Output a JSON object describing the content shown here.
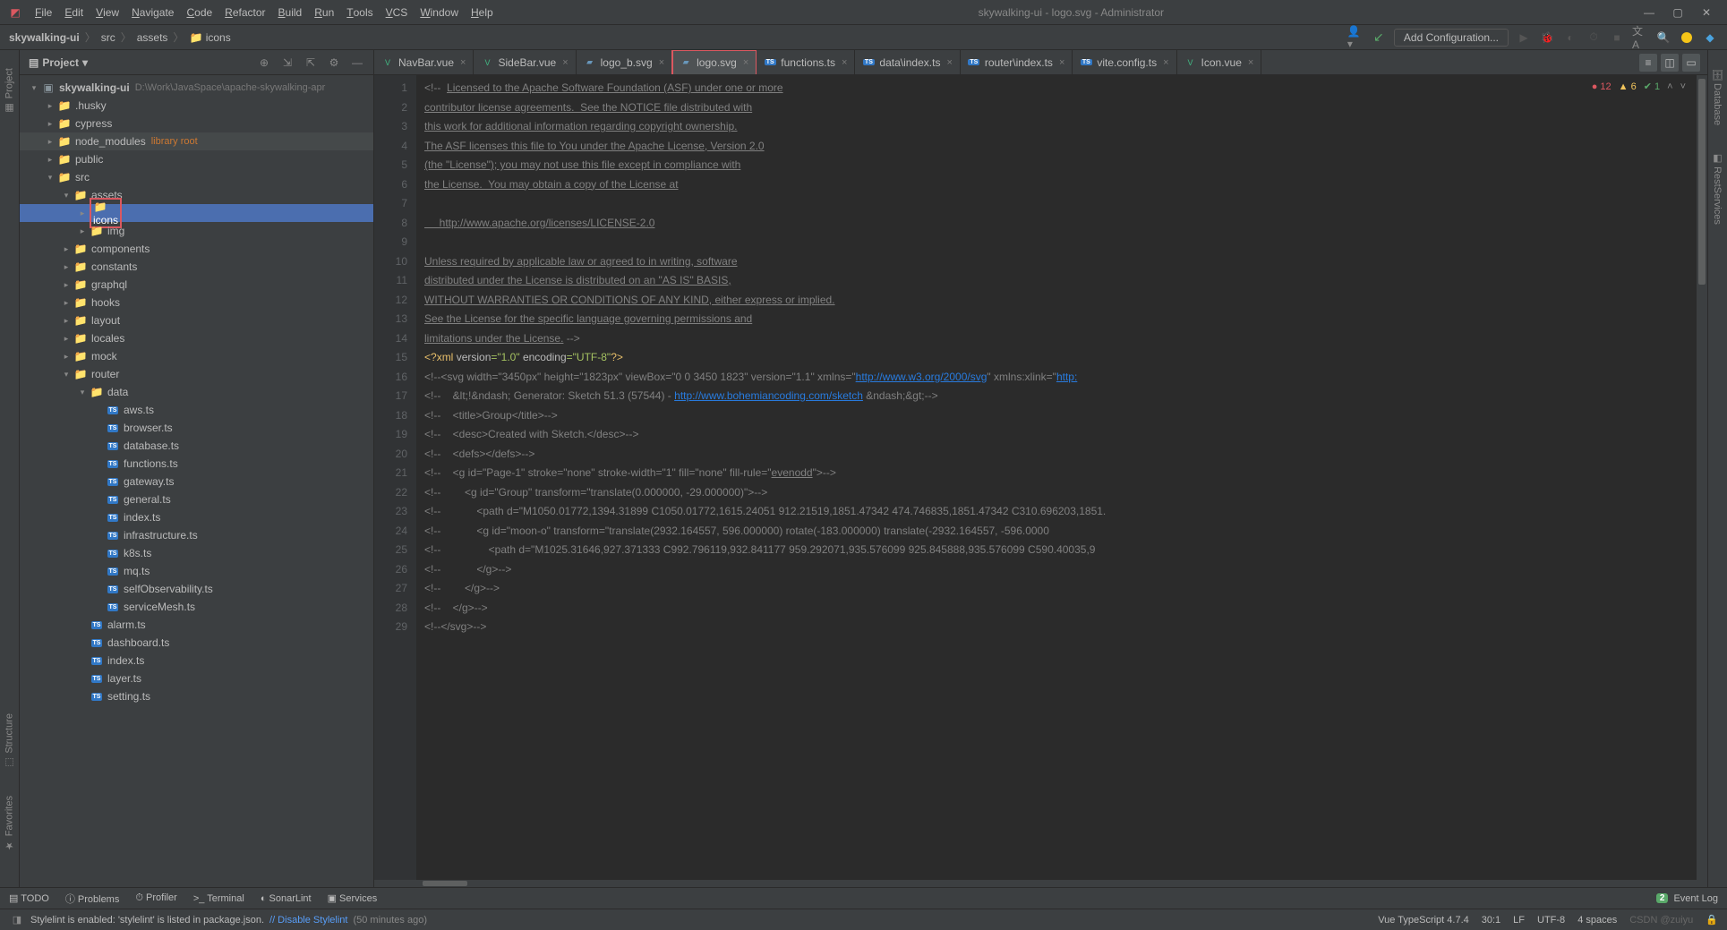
{
  "menu": [
    "File",
    "Edit",
    "View",
    "Navigate",
    "Code",
    "Refactor",
    "Build",
    "Run",
    "Tools",
    "VCS",
    "Window",
    "Help"
  ],
  "window_title": "skywalking-ui - logo.svg - Administrator",
  "breadcrumb": [
    "skywalking-ui",
    "src",
    "assets",
    "icons"
  ],
  "add_configuration": "Add Configuration...",
  "panel": {
    "title": "Project"
  },
  "tree": {
    "root": {
      "name": "skywalking-ui",
      "path": "D:\\Work\\JavaSpace\\apache-skywalking-apr"
    },
    "items": [
      {
        "indent": 1,
        "arrow": ">",
        "type": "folder",
        "name": ".husky"
      },
      {
        "indent": 1,
        "arrow": ">",
        "type": "folder",
        "name": "cypress"
      },
      {
        "indent": 1,
        "arrow": ">",
        "type": "folder",
        "name": "node_modules",
        "lib": "library root",
        "dim": true
      },
      {
        "indent": 1,
        "arrow": ">",
        "type": "folder",
        "name": "public"
      },
      {
        "indent": 1,
        "arrow": "v",
        "type": "folder",
        "name": "src"
      },
      {
        "indent": 2,
        "arrow": "v",
        "type": "folder",
        "name": "assets"
      },
      {
        "indent": 3,
        "arrow": ">",
        "type": "folder",
        "name": "icons",
        "selected": true,
        "red": true
      },
      {
        "indent": 3,
        "arrow": ">",
        "type": "folder",
        "name": "img"
      },
      {
        "indent": 2,
        "arrow": ">",
        "type": "folder",
        "name": "components"
      },
      {
        "indent": 2,
        "arrow": ">",
        "type": "folder",
        "name": "constants"
      },
      {
        "indent": 2,
        "arrow": ">",
        "type": "folder",
        "name": "graphql"
      },
      {
        "indent": 2,
        "arrow": ">",
        "type": "folder",
        "name": "hooks"
      },
      {
        "indent": 2,
        "arrow": ">",
        "type": "folder",
        "name": "layout"
      },
      {
        "indent": 2,
        "arrow": ">",
        "type": "folder",
        "name": "locales"
      },
      {
        "indent": 2,
        "arrow": ">",
        "type": "folder",
        "name": "mock"
      },
      {
        "indent": 2,
        "arrow": "v",
        "type": "folder",
        "name": "router"
      },
      {
        "indent": 3,
        "arrow": "v",
        "type": "folder",
        "name": "data"
      },
      {
        "indent": 4,
        "arrow": "",
        "type": "ts",
        "name": "aws.ts"
      },
      {
        "indent": 4,
        "arrow": "",
        "type": "ts",
        "name": "browser.ts"
      },
      {
        "indent": 4,
        "arrow": "",
        "type": "ts",
        "name": "database.ts"
      },
      {
        "indent": 4,
        "arrow": "",
        "type": "ts",
        "name": "functions.ts"
      },
      {
        "indent": 4,
        "arrow": "",
        "type": "ts",
        "name": "gateway.ts"
      },
      {
        "indent": 4,
        "arrow": "",
        "type": "ts",
        "name": "general.ts"
      },
      {
        "indent": 4,
        "arrow": "",
        "type": "ts",
        "name": "index.ts"
      },
      {
        "indent": 4,
        "arrow": "",
        "type": "ts",
        "name": "infrastructure.ts"
      },
      {
        "indent": 4,
        "arrow": "",
        "type": "ts",
        "name": "k8s.ts"
      },
      {
        "indent": 4,
        "arrow": "",
        "type": "ts",
        "name": "mq.ts"
      },
      {
        "indent": 4,
        "arrow": "",
        "type": "ts",
        "name": "selfObservability.ts"
      },
      {
        "indent": 4,
        "arrow": "",
        "type": "ts",
        "name": "serviceMesh.ts"
      },
      {
        "indent": 3,
        "arrow": "",
        "type": "ts",
        "name": "alarm.ts"
      },
      {
        "indent": 3,
        "arrow": "",
        "type": "ts",
        "name": "dashboard.ts"
      },
      {
        "indent": 3,
        "arrow": "",
        "type": "ts",
        "name": "index.ts"
      },
      {
        "indent": 3,
        "arrow": "",
        "type": "ts",
        "name": "layer.ts"
      },
      {
        "indent": 3,
        "arrow": "",
        "type": "ts",
        "name": "setting.ts"
      }
    ]
  },
  "tabs": [
    {
      "name": "NavBar.vue",
      "icon": "vue"
    },
    {
      "name": "SideBar.vue",
      "icon": "vue"
    },
    {
      "name": "logo_b.svg",
      "icon": "svg"
    },
    {
      "name": "logo.svg",
      "icon": "svg",
      "active": true
    },
    {
      "name": "functions.ts",
      "icon": "ts"
    },
    {
      "name": "data\\index.ts",
      "icon": "ts"
    },
    {
      "name": "router\\index.ts",
      "icon": "ts"
    },
    {
      "name": "vite.config.ts",
      "icon": "ts"
    },
    {
      "name": "Icon.vue",
      "icon": "vue"
    }
  ],
  "inspections": {
    "errors": "12",
    "warnings": "6",
    "weak": "1"
  },
  "code_lines": [
    {
      "n": 1,
      "html": "<span class='c-comment'>&lt;!--  <span class='c-underline'>Licensed to the Apache Software Foundation (ASF) under one or more</span></span>"
    },
    {
      "n": 2,
      "html": "<span class='c-comment c-underline'>contributor license agreements.  See the NOTICE file distributed with</span>"
    },
    {
      "n": 3,
      "html": "<span class='c-comment c-underline'>this work for additional information regarding copyright ownership.</span>"
    },
    {
      "n": 4,
      "html": "<span class='c-comment c-underline'>The ASF licenses this file to You under the Apache License, Version 2.0</span>"
    },
    {
      "n": 5,
      "html": "<span class='c-comment c-underline'>(the &quot;License&quot;); you may not use this file except in compliance with</span>"
    },
    {
      "n": 6,
      "html": "<span class='c-comment c-underline'>the License.  You may obtain a copy of the License at</span>"
    },
    {
      "n": 7,
      "html": ""
    },
    {
      "n": 8,
      "html": "<span class='c-comment c-underline'>     http://www.apache.org/licenses/LICENSE-2.0</span>"
    },
    {
      "n": 9,
      "html": ""
    },
    {
      "n": 10,
      "html": "<span class='c-comment c-underline'>Unless required by applicable law or agreed to in writing, software</span>"
    },
    {
      "n": 11,
      "html": "<span class='c-comment c-underline'>distributed under the License is distributed on an &quot;AS IS&quot; BASIS,</span>"
    },
    {
      "n": 12,
      "html": "<span class='c-comment c-underline'>WITHOUT WARRANTIES OR CONDITIONS OF ANY KIND, either express or implied.</span>"
    },
    {
      "n": 13,
      "html": "<span class='c-comment c-underline'>See the License for the specific language governing permissions and</span>"
    },
    {
      "n": 14,
      "html": "<span class='c-comment'><span class='c-underline'>limitations under the License.</span> --&gt;</span>"
    },
    {
      "n": 15,
      "html": "<span class='c-tag'>&lt;?</span><span class='c-tag'>xml </span><span class='c-attr'>version</span><span class='c-string'>=&quot;1.0&quot;</span> <span class='c-attr'>encoding</span><span class='c-string'>=&quot;UTF-8&quot;</span><span class='c-tag'>?&gt;</span>"
    },
    {
      "n": 16,
      "html": "<span class='c-comment'>&lt;!--&lt;svg width=&quot;3450px&quot; height=&quot;1823px&quot; viewBox=&quot;0 0 3450 1823&quot; version=&quot;1.1&quot; xmlns=&quot;</span><span class='c-url'>http://www.w3.org/2000/svg</span><span class='c-comment'>&quot; xmlns:xlink=&quot;</span><span class='c-url'>http:</span>"
    },
    {
      "n": 17,
      "html": "<span class='c-comment'>&lt;!--    &amp;lt;!&amp;ndash; Generator: Sketch 51.3 (57544) - </span><span class='c-url'>http://www.bohemiancoding.com/sketch</span><span class='c-comment'> &amp;ndash;&amp;gt;--&gt;</span>"
    },
    {
      "n": 18,
      "html": "<span class='c-comment'>&lt;!--    &lt;title&gt;Group&lt;/title&gt;--&gt;</span>"
    },
    {
      "n": 19,
      "html": "<span class='c-comment'>&lt;!--    &lt;desc&gt;Created with Sketch.&lt;/desc&gt;--&gt;</span>"
    },
    {
      "n": 20,
      "html": "<span class='c-comment'>&lt;!--    &lt;defs&gt;&lt;/defs&gt;--&gt;</span>"
    },
    {
      "n": 21,
      "html": "<span class='c-comment'>&lt;!--    &lt;g id=&quot;Page-1&quot; stroke=&quot;none&quot; stroke-width=&quot;1&quot; fill=&quot;none&quot; fill-rule=&quot;<span class='c-underline'>evenodd</span>&quot;&gt;--&gt;</span>"
    },
    {
      "n": 22,
      "html": "<span class='c-comment'>&lt;!--        &lt;g id=&quot;Group&quot; transform=&quot;translate(0.000000, -29.000000)&quot;&gt;--&gt;</span>"
    },
    {
      "n": 23,
      "html": "<span class='c-comment'>&lt;!--            &lt;path d=&quot;M1050.01772,1394.31899 C1050.01772,1615.24051 912.21519,1851.47342 474.746835,1851.47342 C310.696203,1851.</span>"
    },
    {
      "n": 24,
      "html": "<span class='c-comment'>&lt;!--            &lt;g id=&quot;moon-o&quot; transform=&quot;translate(2932.164557, 596.000000) rotate(-183.000000) translate(-2932.164557, -596.0000</span>"
    },
    {
      "n": 25,
      "html": "<span class='c-comment'>&lt;!--                &lt;path d=&quot;M1025.31646,927.371333 C992.796119,932.841177 959.292071,935.576099 925.845888,935.576099 C590.40035,9</span>"
    },
    {
      "n": 26,
      "html": "<span class='c-comment'>&lt;!--            &lt;/g&gt;--&gt;</span>"
    },
    {
      "n": 27,
      "html": "<span class='c-comment'>&lt;!--        &lt;/g&gt;--&gt;</span>"
    },
    {
      "n": 28,
      "html": "<span class='c-comment'>&lt;!--    &lt;/g&gt;--&gt;</span>"
    },
    {
      "n": 29,
      "html": "<span class='c-comment'>&lt;!--&lt;/svg&gt;--&gt;</span>"
    }
  ],
  "bottom_tools": [
    "TODO",
    "Problems",
    "Profiler",
    "Terminal",
    "SonarLint",
    "Services"
  ],
  "event_log": "Event Log",
  "event_log_count": "2",
  "status": {
    "message": "Stylelint is enabled: 'stylelint' is listed in package.json.",
    "action": "// Disable Stylelint",
    "time": "(50 minutes ago)",
    "lang": "Vue TypeScript 4.7.4",
    "pos": "30:1",
    "line_sep": "LF",
    "encoding": "UTF-8",
    "indent": "4 spaces",
    "watermark": "CSDN @zuiyu"
  },
  "left_rails": [
    "Project",
    "Structure",
    "Favorites"
  ],
  "right_rails": [
    "Database",
    "RestServices"
  ]
}
